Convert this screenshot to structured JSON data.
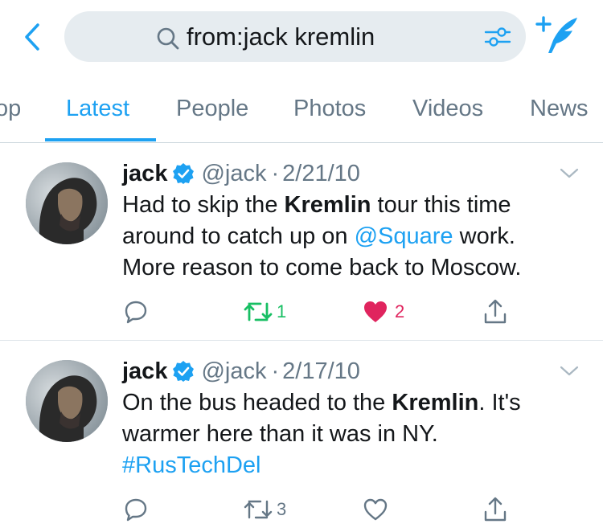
{
  "search": {
    "query": "from:jack kremlin"
  },
  "colors": {
    "accent": "#1da1f2",
    "retweet": "#17bf63",
    "like": "#e0245e",
    "secondary": "#657786"
  },
  "tabs": [
    {
      "label": "op",
      "active": false
    },
    {
      "label": "Latest",
      "active": true
    },
    {
      "label": "People",
      "active": false
    },
    {
      "label": "Photos",
      "active": false
    },
    {
      "label": "Videos",
      "active": false
    },
    {
      "label": "News",
      "active": false
    }
  ],
  "tweets": [
    {
      "name": "jack",
      "handle": "@jack",
      "separator": "·",
      "date": "2/21/10",
      "body": {
        "l1a": "Had to skip the ",
        "l1b": "Kremlin",
        "l1c": " tour this time",
        "l2a": "around to catch up on ",
        "l2b": "@Square",
        "l2c": " work.",
        "l3": "More reason to come back to Moscow."
      },
      "retweets": "1",
      "likes": "2",
      "retweeted": true,
      "liked": true
    },
    {
      "name": "jack",
      "handle": "@jack",
      "separator": "·",
      "date": "2/17/10",
      "body": {
        "l1a": "On the bus headed to the ",
        "l1b": "Kremlin",
        "l1c": ". It's",
        "l2": "warmer here than it was in NY.",
        "l3": "#RusTechDel"
      },
      "retweets": "3",
      "likes": "",
      "retweeted": false,
      "liked": false
    }
  ],
  "icons": {
    "back": "chevron-left-icon",
    "search": "search-icon",
    "filter": "filter-sliders-icon",
    "compose": "compose-tweet-icon",
    "verified": "verified-badge-icon",
    "caret": "chevron-down-icon",
    "reply": "reply-icon",
    "retweet": "retweet-icon",
    "like": "heart-icon",
    "share": "share-icon"
  }
}
